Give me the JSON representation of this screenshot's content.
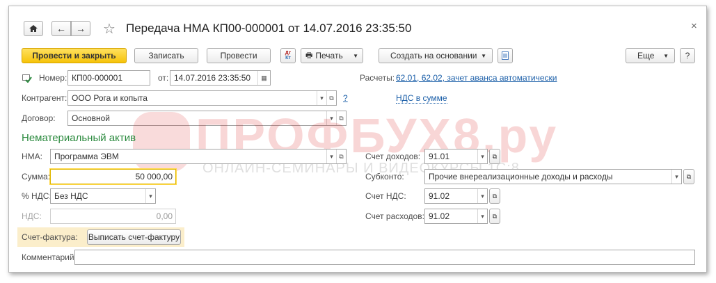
{
  "window": {
    "title": "Передача НМА КП00-000001 от 14.07.2016 23:35:50",
    "close_icon": "close-icon"
  },
  "toolbar": {
    "post_close_label": "Провести и закрыть",
    "save_label": "Записать",
    "post_label": "Провести",
    "print_label": "Печать",
    "create_based_label": "Создать на основании",
    "more_label": "Еще",
    "help_label": "?",
    "dtkt_label": "Дт Кт"
  },
  "header": {
    "number_label": "Номер:",
    "number_value": "КП00-000001",
    "date_label": "от:",
    "date_value": "14.07.2016 23:35:50",
    "settlements_label": "Расчеты:",
    "settlements_link": "62.01, 62.02, зачет аванса автоматически",
    "vat_link": "НДС в сумме",
    "counterparty_label": "Контрагент:",
    "counterparty_value": "ООО Рога и копыта",
    "contract_label": "Договор:",
    "contract_value": "Основной",
    "help_q": "?"
  },
  "section": {
    "title": "Нематериальный актив",
    "nma_label": "НМА:",
    "nma_value": "Программа ЭВМ",
    "sum_label": "Сумма:",
    "sum_value": "50 000,00",
    "vat_rate_label": "% НДС:",
    "vat_rate_value": "Без НДС",
    "vat_label": "НДС:",
    "vat_value": "0,00",
    "invoice_label": "Счет-фактура:",
    "invoice_button": "Выписать счет-фактуру",
    "income_account_label": "Счет доходов:",
    "income_account_value": "91.01",
    "subconto_label": "Субконто:",
    "subconto_value": "Прочие внереализационные доходы и расходы",
    "vat_account_label": "Счет НДС:",
    "vat_account_value": "91.02",
    "expense_account_label": "Счет расходов:",
    "expense_account_value": "91.02"
  },
  "comment": {
    "label": "Комментарий:",
    "value": ""
  },
  "watermark": {
    "main": "ПРОФБУХ8.ру",
    "sub": "ОНЛАЙН-СЕМИНАРЫ И ВИДЕОКУРСЫ 1С:8"
  }
}
